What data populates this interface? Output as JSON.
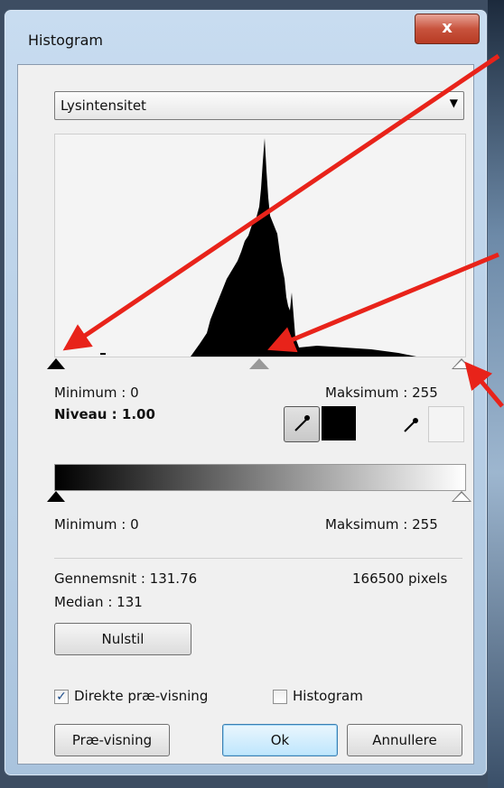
{
  "window": {
    "title": "Histogram",
    "close_label": "x"
  },
  "channel": {
    "selected": "Lysintensitet"
  },
  "input_levels": {
    "minimum_label": "Minimum : 0",
    "maximum_label": "Maksimum : 255",
    "level_label": "Niveau : 1.00"
  },
  "output_levels": {
    "minimum_label": "Minimum : 0",
    "maximum_label": "Maksimum : 255"
  },
  "stats": {
    "mean_label": "Gennemsnit : 131.76",
    "pixels_label": "166500 pixels",
    "median_label": "Median : 131"
  },
  "buttons": {
    "reset": "Nulstil",
    "preview": "Præ-visning",
    "ok": "Ok",
    "cancel": "Annullere"
  },
  "checkboxes": {
    "live_preview": {
      "label": "Direkte præ-visning",
      "checked": true
    },
    "histogram": {
      "label": "Histogram",
      "checked": false
    }
  },
  "colors": {
    "annotation_arrow": "#e8231a",
    "accent": "#3c7fb1"
  },
  "icons": [
    "close-icon",
    "chevron-down-icon",
    "eyedropper-icon",
    "check-icon"
  ]
}
